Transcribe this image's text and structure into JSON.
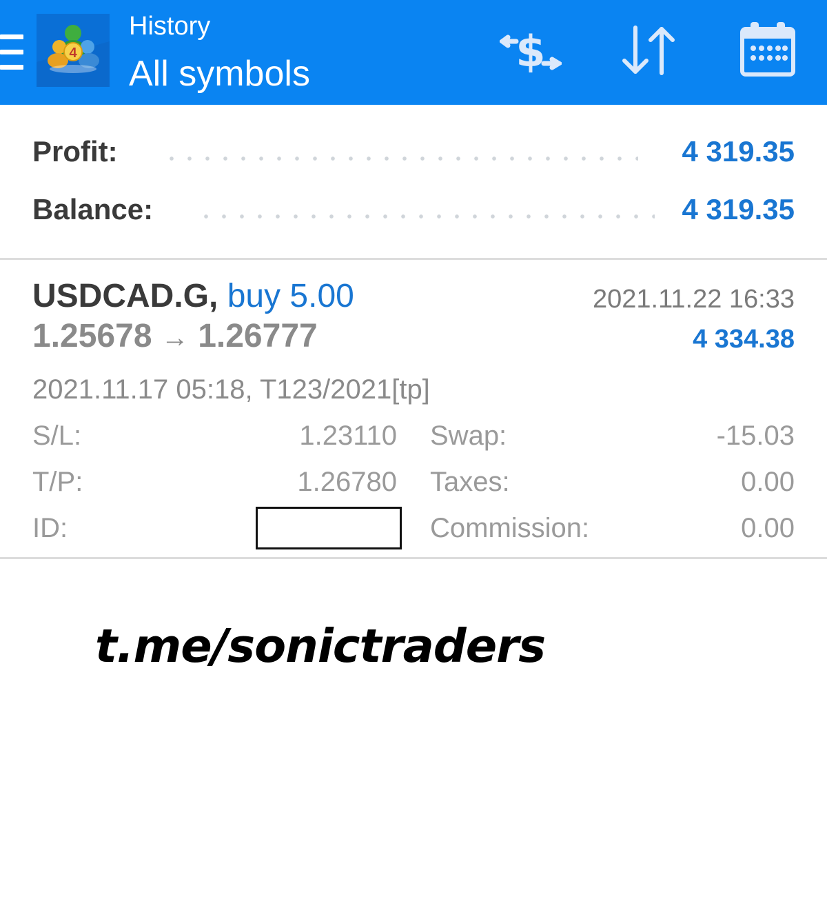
{
  "header": {
    "title_small": "History",
    "title_big": "All symbols",
    "icons": [
      "menu-icon",
      "metatrader-logo",
      "currency-exchange-icon",
      "sort-icon",
      "calendar-icon"
    ],
    "accent_color": "#0a84f2"
  },
  "summary": {
    "profit_label": "Profit:",
    "profit_value": "4 319.35",
    "balance_label": "Balance:",
    "balance_value": "4 319.35"
  },
  "deal": {
    "symbol": "USDCAD.G,",
    "action": "buy 5.00",
    "open_price": "1.25678",
    "arrow": "→",
    "close_price": "1.26777",
    "close_time": "2021.11.22 16:33",
    "profit": "4 334.38",
    "open_info": "2021.11.17 05:18, T123/2021[tp]",
    "sl_label": "S/L:",
    "sl_value": "1.23110",
    "tp_label": "T/P:",
    "tp_value": "1.26780",
    "id_label": "ID:",
    "swap_label": "Swap:",
    "swap_value": "-15.03",
    "taxes_label": "Taxes:",
    "taxes_value": "0.00",
    "commission_label": "Commission:",
    "commission_value": "0.00"
  },
  "watermark": "t.me/sonictraders"
}
